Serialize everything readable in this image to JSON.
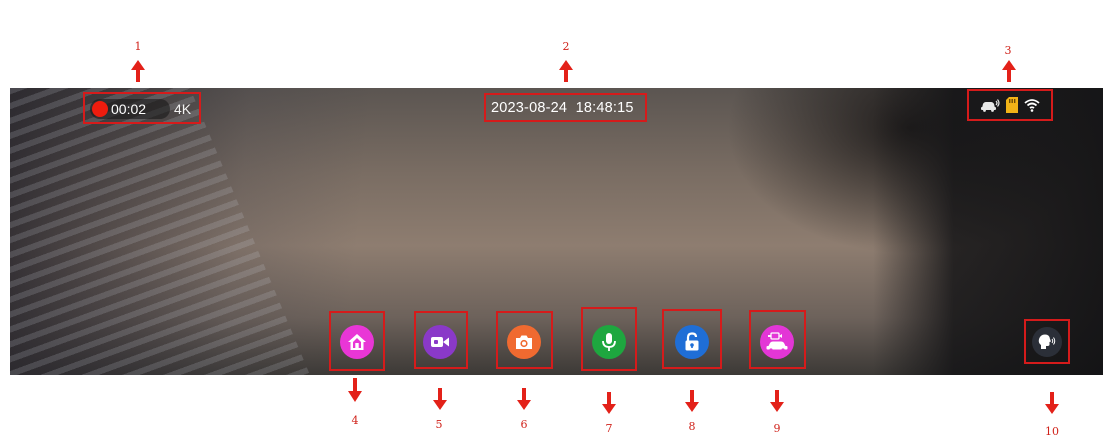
{
  "annotations": [
    "1",
    "2",
    "3",
    "4",
    "5",
    "6",
    "7",
    "8",
    "9",
    "10"
  ],
  "hud": {
    "recording_time": "00:02",
    "resolution": "4K",
    "datetime": "2023-08-24  18:48:15"
  },
  "status_icons": [
    "car-signal-icon",
    "sd-card-icon",
    "wifi-icon"
  ],
  "buttons": [
    {
      "name": "home-button",
      "icon": "home-icon",
      "color": "#e936d6"
    },
    {
      "name": "record-video-button",
      "icon": "video-camera-icon",
      "color": "#8a39c8"
    },
    {
      "name": "take-photo-button",
      "icon": "camera-icon",
      "color": "#f06a30"
    },
    {
      "name": "microphone-button",
      "icon": "microphone-icon",
      "color": "#1ea73f"
    },
    {
      "name": "lock-button",
      "icon": "unlock-icon",
      "color": "#1f6ed6"
    },
    {
      "name": "car-camera-switch-button",
      "icon": "car-camera-icon",
      "color": "#e336d6"
    },
    {
      "name": "voice-command-button",
      "icon": "speaking-head-icon",
      "color": "#2b2f38"
    }
  ],
  "colors": {
    "annotation_red": "#d51b1b",
    "record_red": "#ee1c0e"
  }
}
